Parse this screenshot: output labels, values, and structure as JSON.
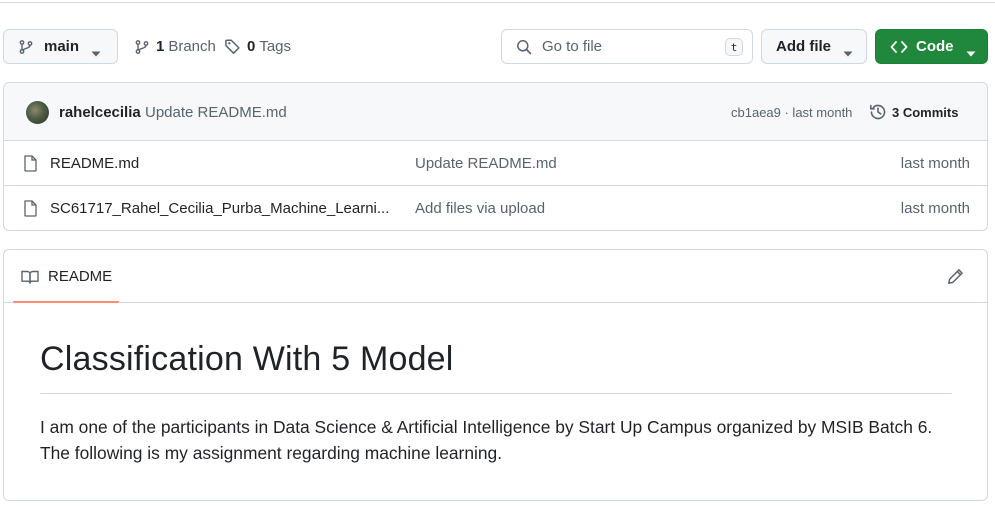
{
  "toolbar": {
    "branch_name": "main",
    "branches_count": "1",
    "branches_label": "Branch",
    "tags_count": "0",
    "tags_label": "Tags",
    "search_placeholder": "Go to file",
    "search_shortcut": "t",
    "add_file_label": "Add file",
    "code_label": "Code"
  },
  "latest_commit": {
    "author": "rahelcecilia",
    "message": "Update README.md",
    "sha_time": "cb1aea9 · last month",
    "commits_label": "3 Commits"
  },
  "files": [
    {
      "name": "README.md",
      "commit_message": "Update README.md",
      "time": "last month"
    },
    {
      "name": "SC61717_Rahel_Cecilia_Purba_Machine_Learni...",
      "commit_message": "Add files via upload",
      "time": "last month"
    }
  ],
  "readme": {
    "tab_label": "README",
    "title": "Classification With 5 Model",
    "paragraph": "I am one of the participants in Data Science & Artificial Intelligence by Start Up Campus organized by MSIB Batch 6. The following is my assignment regarding machine learning."
  },
  "colors": {
    "accent_green": "#1f883d",
    "tab_underline": "#fd8c73",
    "border": "#d1d9e0",
    "muted_text": "#59636e"
  },
  "icons": [
    "git-branch-icon",
    "chevron-down-icon",
    "tag-icon",
    "search-icon",
    "code-icon",
    "history-icon",
    "file-icon",
    "book-icon",
    "pencil-icon"
  ]
}
